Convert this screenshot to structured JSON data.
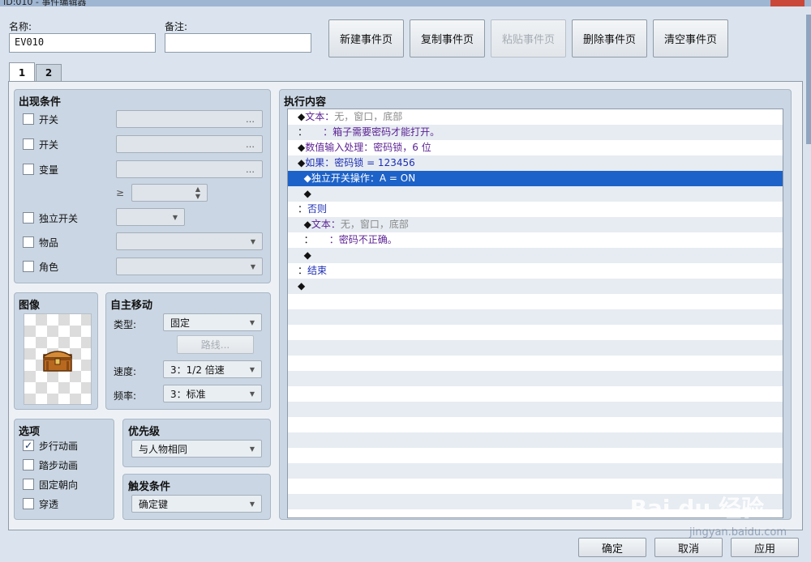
{
  "window": {
    "title": "ID:010 - 事件编辑器"
  },
  "name_field": {
    "label": "名称:",
    "value": "EV010"
  },
  "note_field": {
    "label": "备注:",
    "value": ""
  },
  "toolbar": {
    "new_page": "新建事件页",
    "copy_page": "复制事件页",
    "paste_page": "粘贴事件页",
    "delete_page": "删除事件页",
    "clear_page": "清空事件页"
  },
  "tabs": [
    {
      "label": "1"
    },
    {
      "label": "2"
    }
  ],
  "conditions": {
    "title": "出现条件",
    "switch1": "开关",
    "switch2": "开关",
    "variable": "变量",
    "ge": "≥",
    "self_switch": "独立开关",
    "item": "物品",
    "actor": "角色",
    "dots": "…"
  },
  "image": {
    "title": "图像"
  },
  "autonomous": {
    "title": "自主移动",
    "type_label": "类型:",
    "type_value": "固定",
    "route_button": "路线...",
    "speed_label": "速度:",
    "speed_value": "3：1/2 倍速",
    "freq_label": "频率:",
    "freq_value": "3：标准"
  },
  "options": {
    "title": "选项",
    "walk_anim": "步行动画",
    "step_anim": "踏步动画",
    "dir_fix": "固定朝向",
    "through": "穿透",
    "walk_anim_checked": true
  },
  "priority": {
    "title": "优先级",
    "value": "与人物相同"
  },
  "trigger": {
    "title": "触发条件",
    "value": "确定键"
  },
  "contents": {
    "title": "执行内容",
    "rows": [
      {
        "marker": "◆",
        "cmd": "文本：",
        "detail": "无，窗口，底部",
        "cmdClass": "c-purple",
        "detailClass": "c-gray"
      },
      {
        "marker": "：",
        "cmd": "",
        "detail": "     ：箱子需要密码才能打开。",
        "cmdClass": "c-purple",
        "detailClass": "c-purple"
      },
      {
        "marker": "◆",
        "cmd": "数值输入处理：",
        "detail": "密码锁，6 位",
        "cmdClass": "c-purple",
        "detailClass": "c-purple"
      },
      {
        "marker": "◆",
        "cmd": "如果：",
        "detail": "密码锁 = 123456",
        "cmdClass": "c-blue",
        "detailClass": "c-blue"
      },
      {
        "marker": "  ◆",
        "cmd": "独立开关操作：",
        "detail": "A = ON",
        "cmdClass": "c-dark",
        "detailClass": "c-dark",
        "selected": true
      },
      {
        "marker": "  ◆",
        "cmd": "",
        "detail": "",
        "cmdClass": "c-dark",
        "detailClass": "c-dark"
      },
      {
        "marker": "：",
        "cmd": "否则",
        "detail": "",
        "cmdClass": "c-blue",
        "detailClass": "c-blue"
      },
      {
        "marker": "  ◆",
        "cmd": "文本：",
        "detail": "无，窗口，底部",
        "cmdClass": "c-purple",
        "detailClass": "c-gray"
      },
      {
        "marker": "  ：",
        "cmd": "",
        "detail": "     ：密码不正确。",
        "cmdClass": "c-purple",
        "detailClass": "c-purple"
      },
      {
        "marker": "  ◆",
        "cmd": "",
        "detail": "",
        "cmdClass": "c-dark",
        "detailClass": "c-dark"
      },
      {
        "marker": "：",
        "cmd": "结束",
        "detail": "",
        "cmdClass": "c-blue",
        "detailClass": "c-blue"
      },
      {
        "marker": "◆",
        "cmd": "",
        "detail": "",
        "cmdClass": "c-dark",
        "detailClass": "c-dark"
      }
    ],
    "blank_rows": 14
  },
  "footer": {
    "ok": "确定",
    "cancel": "取消",
    "apply": "应用"
  },
  "watermark": {
    "brand": "Bai du 经验",
    "url": "jingyan.baidu.com"
  }
}
